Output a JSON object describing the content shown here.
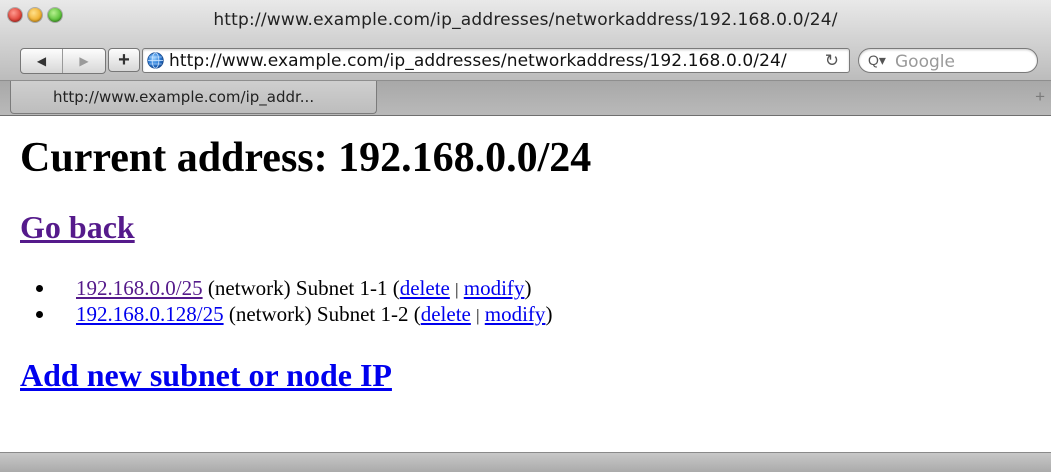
{
  "window": {
    "title": "http://www.example.com/ip_addresses/networkaddress/192.168.0.0/24/"
  },
  "toolbar": {
    "back_icon": "◀",
    "forward_icon": "▶",
    "add_icon": "+",
    "url": "http://www.example.com/ip_addresses/networkaddress/192.168.0.0/24/",
    "reload_icon": "↻",
    "search_icon": "Q▾",
    "search_placeholder": "Google"
  },
  "tabs": [
    {
      "label": "http://www.example.com/ip_addr..."
    }
  ],
  "tabstrip": {
    "new_tab_icon": "+"
  },
  "page": {
    "heading": "Current address: 192.168.0.0/24",
    "go_back": "Go back",
    "subnets": [
      {
        "address": "192.168.0.0/25",
        "text": "(network) Subnet 1-1 (",
        "delete": "delete",
        "separator": "|",
        "modify": "modify",
        "close": ")"
      },
      {
        "address": "192.168.0.128/25",
        "text": "(network) Subnet 1-2 (",
        "delete": "delete",
        "separator": "|",
        "modify": "modify",
        "close": ")"
      }
    ],
    "add_new": "Add new subnet or node IP"
  }
}
